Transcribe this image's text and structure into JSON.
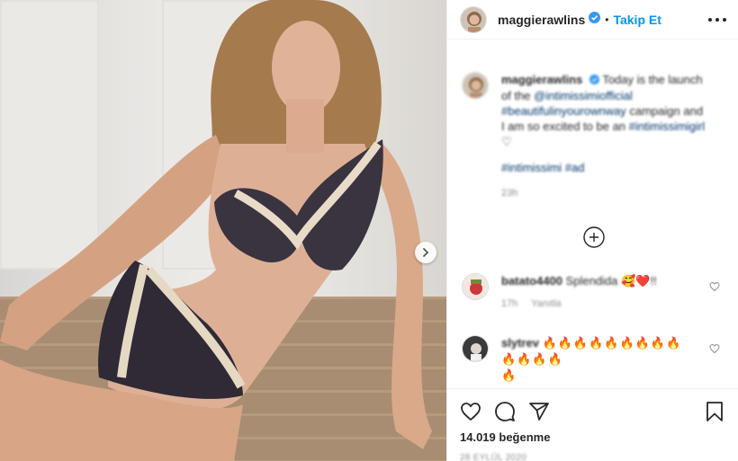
{
  "post": {
    "username": "maggierawlins",
    "follow_label": "Takip Et",
    "separator": "•",
    "caption": {
      "username": "maggierawlins",
      "text_before": "Today is the launch of the ",
      "mention": "@intimissimiofficial",
      "hashtag1": "#beautifulinyourownway",
      "text_mid": " campaign and I am so excited to be an ",
      "hashtag2": "#intimissimigirl",
      "tags_line": "#intimissimi #ad",
      "time": "23h"
    },
    "comments": [
      {
        "username": "batato4400",
        "text": "Splendida",
        "emoji": "🥰❤️",
        "suffix": "!!",
        "time": "17h",
        "reply_label": "Yanıtla"
      },
      {
        "username": "slytrev",
        "emoji_line1": "🔥🔥🔥🔥🔥🔥🔥🔥🔥🔥🔥🔥🔥",
        "emoji_line2": "🔥"
      }
    ],
    "likes": "14.019 beğenme",
    "date": "28 EYLÜL 2020"
  },
  "colors": {
    "accent": "#0095f6",
    "verified": "#3897f0",
    "heart": "#ed4956",
    "text": "#262626",
    "muted": "#8e8e8e"
  },
  "icons": [
    "chevron-right-icon",
    "more-icon",
    "verified-icon",
    "plus-circle-icon",
    "heart-icon",
    "comment-icon",
    "share-icon",
    "bookmark-icon"
  ]
}
